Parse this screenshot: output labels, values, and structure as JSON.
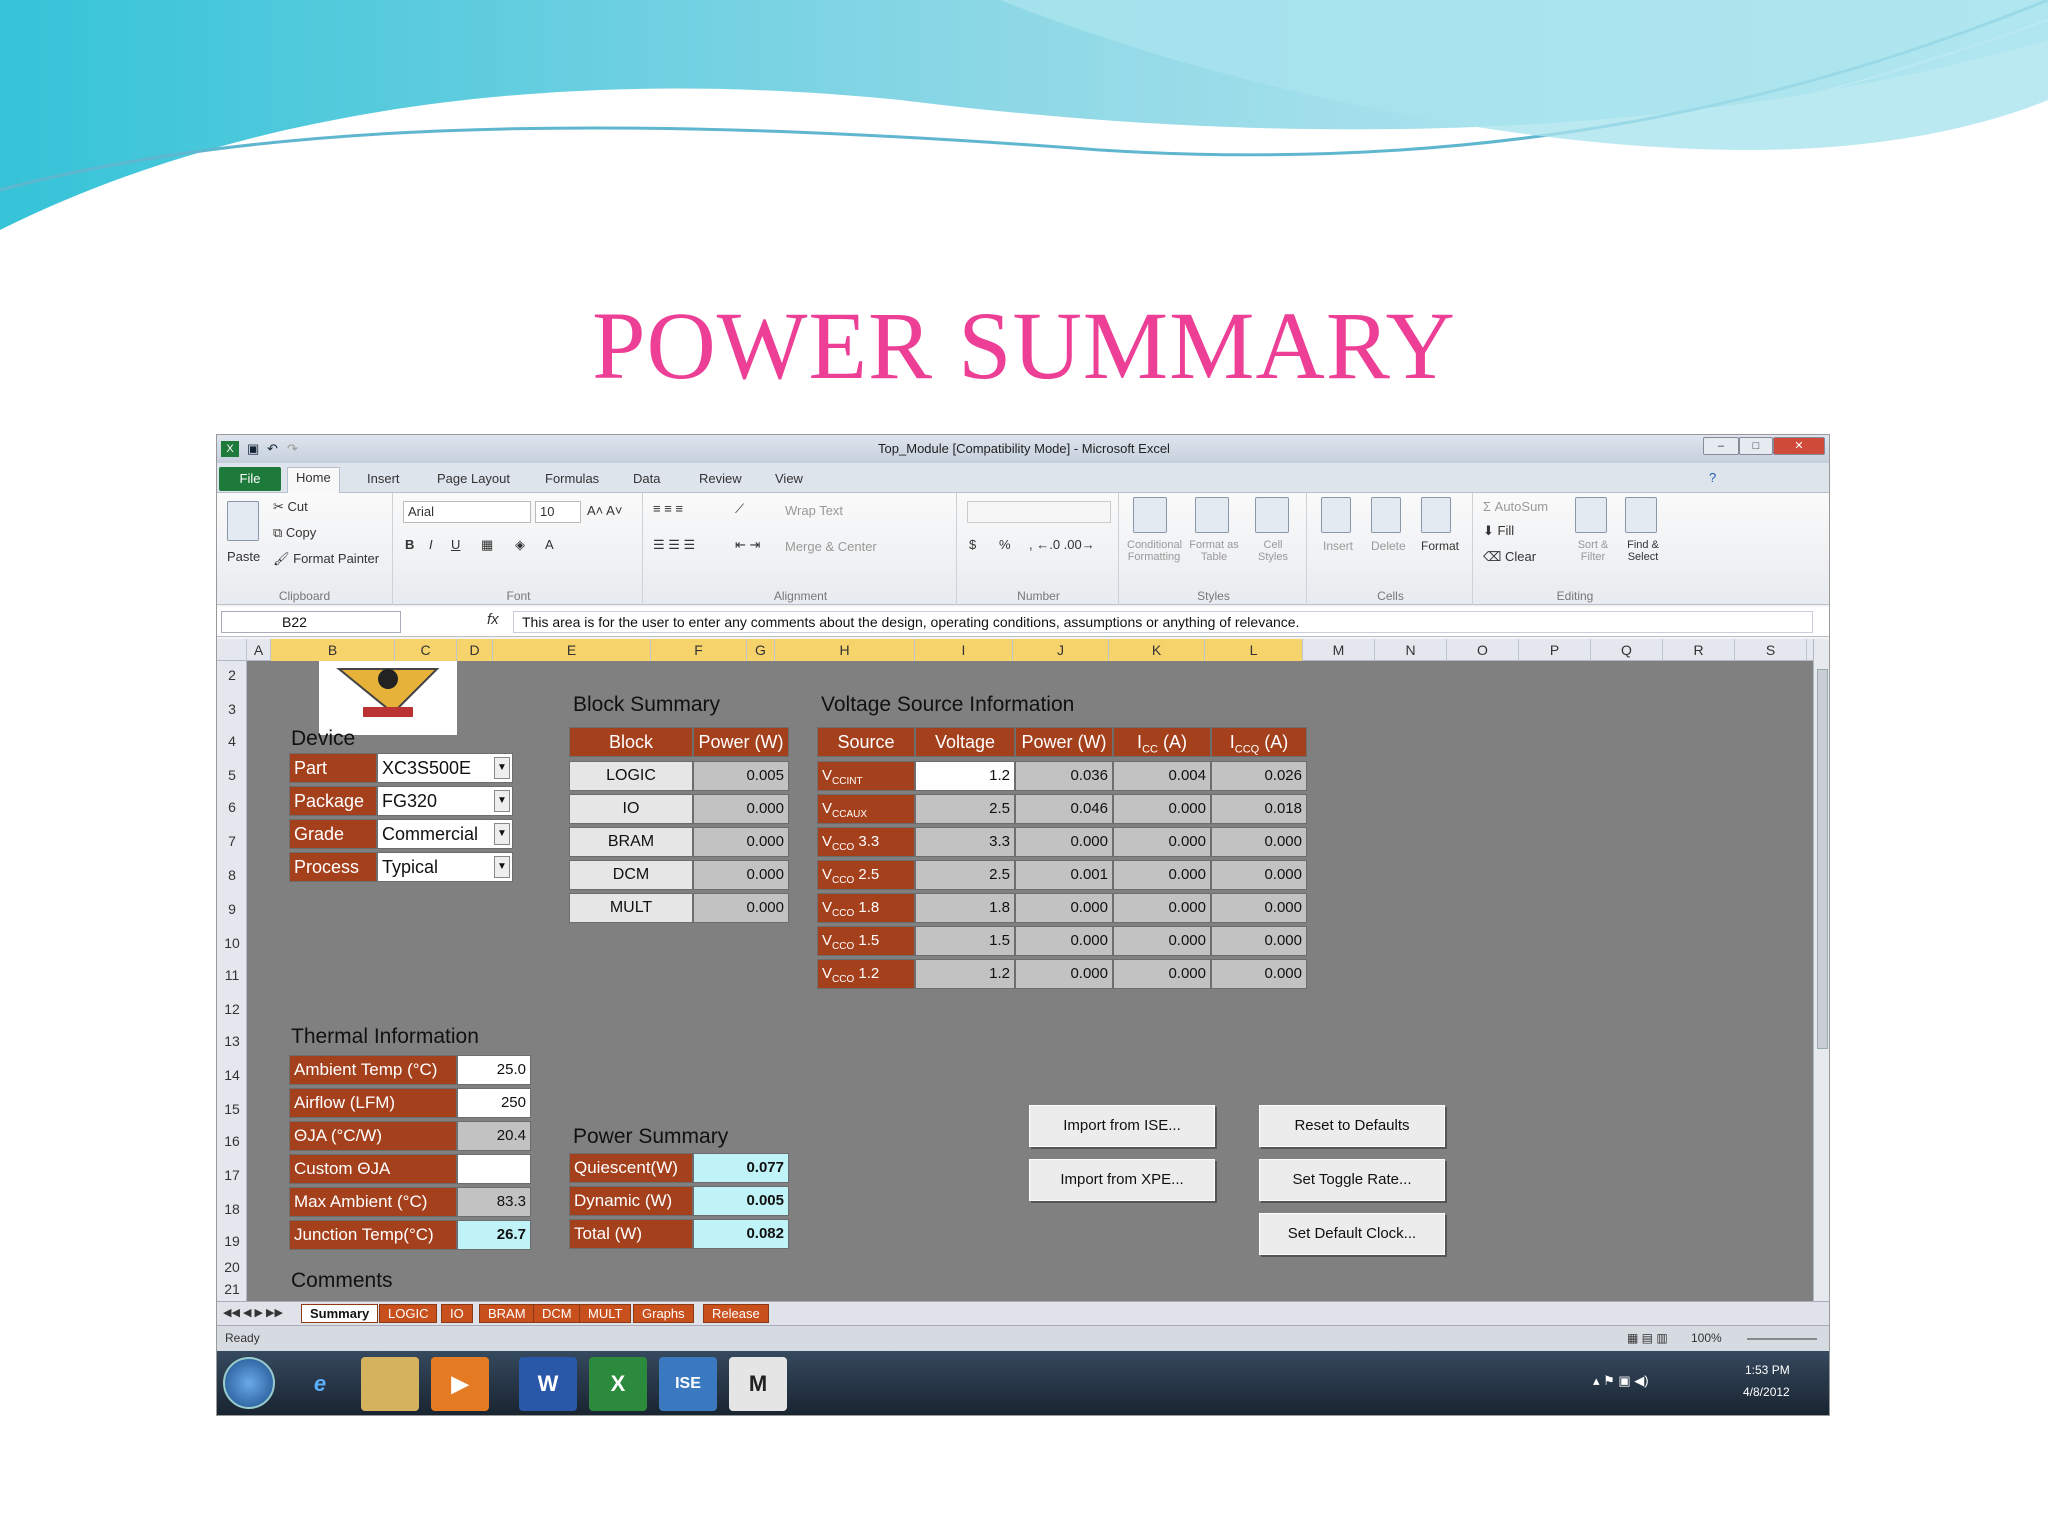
{
  "slide": {
    "title": "POWER SUMMARY"
  },
  "window": {
    "title": "Top_Module [Compatibility Mode] - Microsoft Excel"
  },
  "ribbon": {
    "tabs": [
      "File",
      "Home",
      "Insert",
      "Page Layout",
      "Formulas",
      "Data",
      "Review",
      "View"
    ],
    "clipboard": {
      "paste": "Paste",
      "cut": "Cut",
      "copy": "Copy",
      "format_painter": "Format Painter",
      "label": "Clipboard"
    },
    "font": {
      "name": "Arial",
      "size": "10",
      "label": "Font"
    },
    "alignment": {
      "wrap_text": "Wrap Text",
      "merge_center": "Merge & Center",
      "label": "Alignment"
    },
    "number": {
      "currency": "$",
      "percent": "%",
      "label": "Number"
    },
    "styles": {
      "conditional": "Conditional Formatting",
      "format_table": "Format as Table",
      "cell_styles": "Cell Styles",
      "label": "Styles"
    },
    "cells": {
      "insert": "Insert",
      "delete": "Delete",
      "format": "Format",
      "label": "Cells"
    },
    "editing": {
      "autosum": "AutoSum",
      "fill": "Fill",
      "clear": "Clear",
      "sort": "Sort & Filter",
      "find": "Find & Select",
      "label": "Editing"
    }
  },
  "formula_bar": {
    "name_box": "B22",
    "fx": "fx",
    "content": "This area is for the user to enter any comments about the design, operating conditions, assumptions or anything of relevance."
  },
  "columns": [
    "A",
    "B",
    "C",
    "D",
    "E",
    "F",
    "G",
    "H",
    "I",
    "J",
    "K",
    "L",
    "M",
    "N",
    "O",
    "P",
    "Q",
    "R",
    "S"
  ],
  "rows": [
    "2",
    "3",
    "4",
    "5",
    "6",
    "7",
    "8",
    "9",
    "10",
    "11",
    "12",
    "13",
    "14",
    "15",
    "16",
    "17",
    "18",
    "19",
    "20",
    "21"
  ],
  "device": {
    "heading": "Device",
    "rows": [
      {
        "label": "Part",
        "value": "XC3S500E"
      },
      {
        "label": "Package",
        "value": "FG320"
      },
      {
        "label": "Grade",
        "value": "Commercial"
      },
      {
        "label": "Process",
        "value": "Typical"
      }
    ]
  },
  "block_summary": {
    "heading": "Block Summary",
    "headers": [
      "Block",
      "Power (W)"
    ],
    "rows": [
      [
        "LOGIC",
        "0.005"
      ],
      [
        "IO",
        "0.000"
      ],
      [
        "BRAM",
        "0.000"
      ],
      [
        "DCM",
        "0.000"
      ],
      [
        "MULT",
        "0.000"
      ]
    ]
  },
  "voltage_source": {
    "heading": "Voltage Source Information",
    "headers": [
      {
        "main": "Source",
        "sub": ""
      },
      {
        "main": "Voltage",
        "sub": ""
      },
      {
        "main": "Power (W)",
        "sub": ""
      },
      {
        "main": "I",
        "sub": "CC",
        "unit": " (A)"
      },
      {
        "main": "I",
        "sub": "CCQ",
        "unit": " (A)"
      }
    ],
    "rows": [
      {
        "v": "V",
        "sub": "CCINT",
        "suffix": "",
        "voltage": "1.2",
        "power": "0.036",
        "icc": "0.004",
        "iccq": "0.026"
      },
      {
        "v": "V",
        "sub": "CCAUX",
        "suffix": "",
        "voltage": "2.5",
        "power": "0.046",
        "icc": "0.000",
        "iccq": "0.018"
      },
      {
        "v": "V",
        "sub": "CCO",
        "suffix": " 3.3",
        "voltage": "3.3",
        "power": "0.000",
        "icc": "0.000",
        "iccq": "0.000"
      },
      {
        "v": "V",
        "sub": "CCO",
        "suffix": " 2.5",
        "voltage": "2.5",
        "power": "0.001",
        "icc": "0.000",
        "iccq": "0.000"
      },
      {
        "v": "V",
        "sub": "CCO",
        "suffix": " 1.8",
        "voltage": "1.8",
        "power": "0.000",
        "icc": "0.000",
        "iccq": "0.000"
      },
      {
        "v": "V",
        "sub": "CCO",
        "suffix": " 1.5",
        "voltage": "1.5",
        "power": "0.000",
        "icc": "0.000",
        "iccq": "0.000"
      },
      {
        "v": "V",
        "sub": "CCO",
        "suffix": " 1.2",
        "voltage": "1.2",
        "power": "0.000",
        "icc": "0.000",
        "iccq": "0.000"
      }
    ]
  },
  "thermal": {
    "heading": "Thermal Information",
    "rows": [
      {
        "label": "Ambient Temp (°C)",
        "value": "25.0",
        "style": "white"
      },
      {
        "label": "Airflow (LFM)",
        "value": "250",
        "style": "white"
      },
      {
        "label": "ΘJA (°C/W)",
        "value": "20.4",
        "style": "gray"
      },
      {
        "label": "Custom ΘJA",
        "value": "",
        "style": "white"
      },
      {
        "label": "Max Ambient (°C)",
        "value": "83.3",
        "style": "gray"
      },
      {
        "label": "Junction Temp(°C)",
        "value": "26.7",
        "style": "cyan"
      }
    ]
  },
  "power_summary": {
    "heading": "Power Summary",
    "rows": [
      {
        "label": "Quiescent(W)",
        "value": "0.077"
      },
      {
        "label": "Dynamic (W)",
        "value": "0.005"
      },
      {
        "label": "Total (W)",
        "value": "0.082"
      }
    ]
  },
  "buttons": {
    "import_ise": "Import from ISE...",
    "import_xpe": "Import from XPE...",
    "reset": "Reset to Defaults",
    "toggle": "Set Toggle Rate...",
    "clock": "Set Default Clock..."
  },
  "comments": {
    "heading": "Comments"
  },
  "sheet_tabs": [
    "Summary",
    "LOGIC",
    "IO",
    "BRAM",
    "DCM",
    "MULT",
    "Graphs",
    "Release"
  ],
  "status": {
    "ready": "Ready",
    "zoom": "100%"
  },
  "taskbar": {
    "time": "1:53 PM",
    "date": "4/8/2012",
    "apps": [
      "e",
      "W",
      "X",
      "ISE",
      "M"
    ]
  },
  "colors": {
    "title": "#ec3f95",
    "label_bg": "#a5401d",
    "grid_bg": "#808080",
    "result_bg": "#bff3f7"
  }
}
